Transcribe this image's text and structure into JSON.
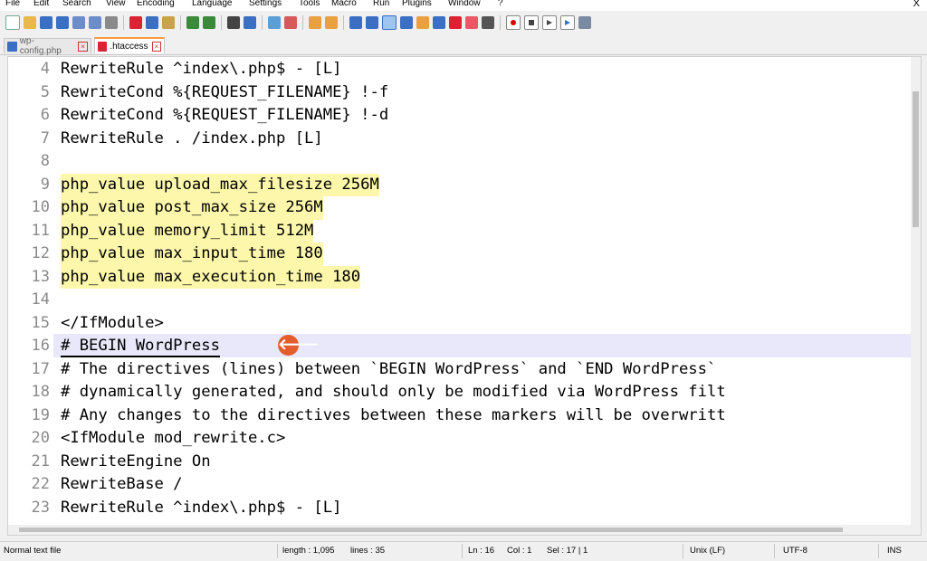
{
  "menubar": {
    "items": [
      "File",
      "Edit",
      "Search",
      "View",
      "Encoding",
      "Language",
      "Settings",
      "Tools",
      "Macro",
      "Run",
      "Plugins",
      "Window",
      "?"
    ],
    "close_label": "X"
  },
  "toolbar": {
    "icons": [
      "new-file",
      "open-file",
      "save",
      "save-all",
      "close",
      "close-all",
      "print",
      "cut",
      "copy",
      "paste",
      "undo",
      "redo",
      "find",
      "replace",
      "zoom-in",
      "zoom-out",
      "sync-v",
      "sync-h",
      "word-wrap",
      "all-chars",
      "indent-guide",
      "user-lang",
      "doc-map",
      "function-list",
      "folder-workspace",
      "monitor",
      "record-macro",
      "stop-record",
      "play-macro",
      "run-multiple",
      "save-macro"
    ]
  },
  "tabs": [
    {
      "label": "wp-config.php",
      "active": false
    },
    {
      "label": ".htaccess",
      "active": true
    }
  ],
  "editor": {
    "lines": [
      {
        "num": "4",
        "text": "RewriteRule ^index\\.php$ - [L]"
      },
      {
        "num": "5",
        "text": "RewriteCond %{REQUEST_FILENAME} !-f"
      },
      {
        "num": "6",
        "text": "RewriteCond %{REQUEST_FILENAME} !-d"
      },
      {
        "num": "7",
        "text": "RewriteRule . /index.php [L]"
      },
      {
        "num": "8",
        "text": ""
      },
      {
        "num": "9",
        "text": "php_value upload_max_filesize 256M"
      },
      {
        "num": "10",
        "text": "php_value post_max_size 256M"
      },
      {
        "num": "11",
        "text": "php_value memory_limit 512M"
      },
      {
        "num": "12",
        "text": "php_value max_input_time 180"
      },
      {
        "num": "13",
        "text": "php_value max_execution_time 180"
      },
      {
        "num": "14",
        "text": ""
      },
      {
        "num": "15",
        "text": "</IfModule>"
      },
      {
        "num": "16",
        "text": "# BEGIN WordPress"
      },
      {
        "num": "17",
        "text": "# The directives (lines) between `BEGIN WordPress` and `END WordPress`"
      },
      {
        "num": "18",
        "text": "# dynamically generated, and should only be modified via WordPress filt"
      },
      {
        "num": "19",
        "text": "# Any changes to the directives between these markers will be overwritt"
      },
      {
        "num": "20",
        "text": "<IfModule mod_rewrite.c>"
      },
      {
        "num": "21",
        "text": "RewriteEngine On"
      },
      {
        "num": "22",
        "text": "RewriteBase /"
      },
      {
        "num": "23",
        "text": "RewriteRule ^index\\.php$ - [L]"
      }
    ],
    "arrow_glyph": "🡐"
  },
  "statusbar": {
    "file_type": "Normal text file",
    "length": "length : 1,095",
    "lines": "lines : 35",
    "position": "Ln : 16",
    "column": "Col : 1",
    "selection": "Sel : 17 | 1",
    "eol": "Unix (LF)",
    "encoding": "UTF-8",
    "mode": "INS"
  },
  "colors": {
    "highlight": "#fcf7ab",
    "current_line": "#e8e8fa",
    "callout": "#e35d2d",
    "tab_accent": "#ff9a3c"
  }
}
